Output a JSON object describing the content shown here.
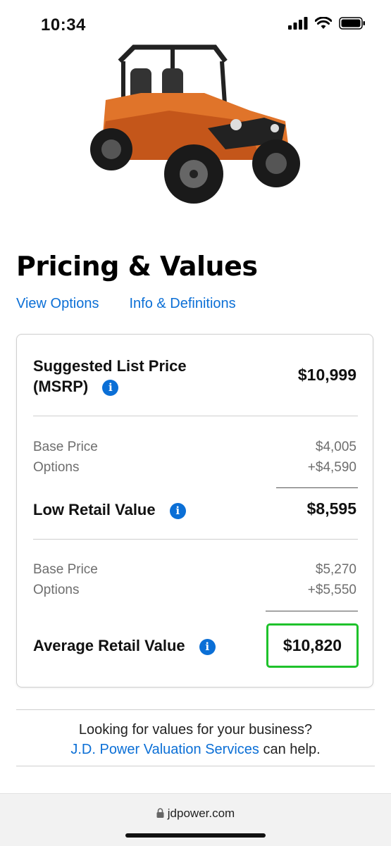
{
  "status": {
    "time": "10:34"
  },
  "hero": {
    "icon": "utv-vehicle-image",
    "accent": "#e0742a"
  },
  "page": {
    "title": "Pricing & Values"
  },
  "links": {
    "view_options": "View Options",
    "info_definitions": "Info & Definitions"
  },
  "card": {
    "msrp": {
      "label_line1": "Suggested List Price",
      "label_line2": "(MSRP)",
      "value": "$10,999"
    },
    "low": {
      "base_label": "Base Price",
      "base_value": "$4,005",
      "options_label": "Options",
      "options_value": "+$4,590",
      "label": "Low Retail Value",
      "value": "$8,595"
    },
    "average": {
      "base_label": "Base Price",
      "base_value": "$5,270",
      "options_label": "Options",
      "options_value": "+$5,550",
      "label": "Average Retail Value",
      "value": "$10,820"
    },
    "info_glyph": "i"
  },
  "promo": {
    "line1": "Looking for values for your business?",
    "link": "J.D. Power Valuation Services",
    "line2_suffix": " can help."
  },
  "browser": {
    "url": "jdpower.com"
  },
  "colors": {
    "link": "#0b6fd6",
    "highlight": "#1ec22b",
    "info": "#0b6fd6"
  }
}
